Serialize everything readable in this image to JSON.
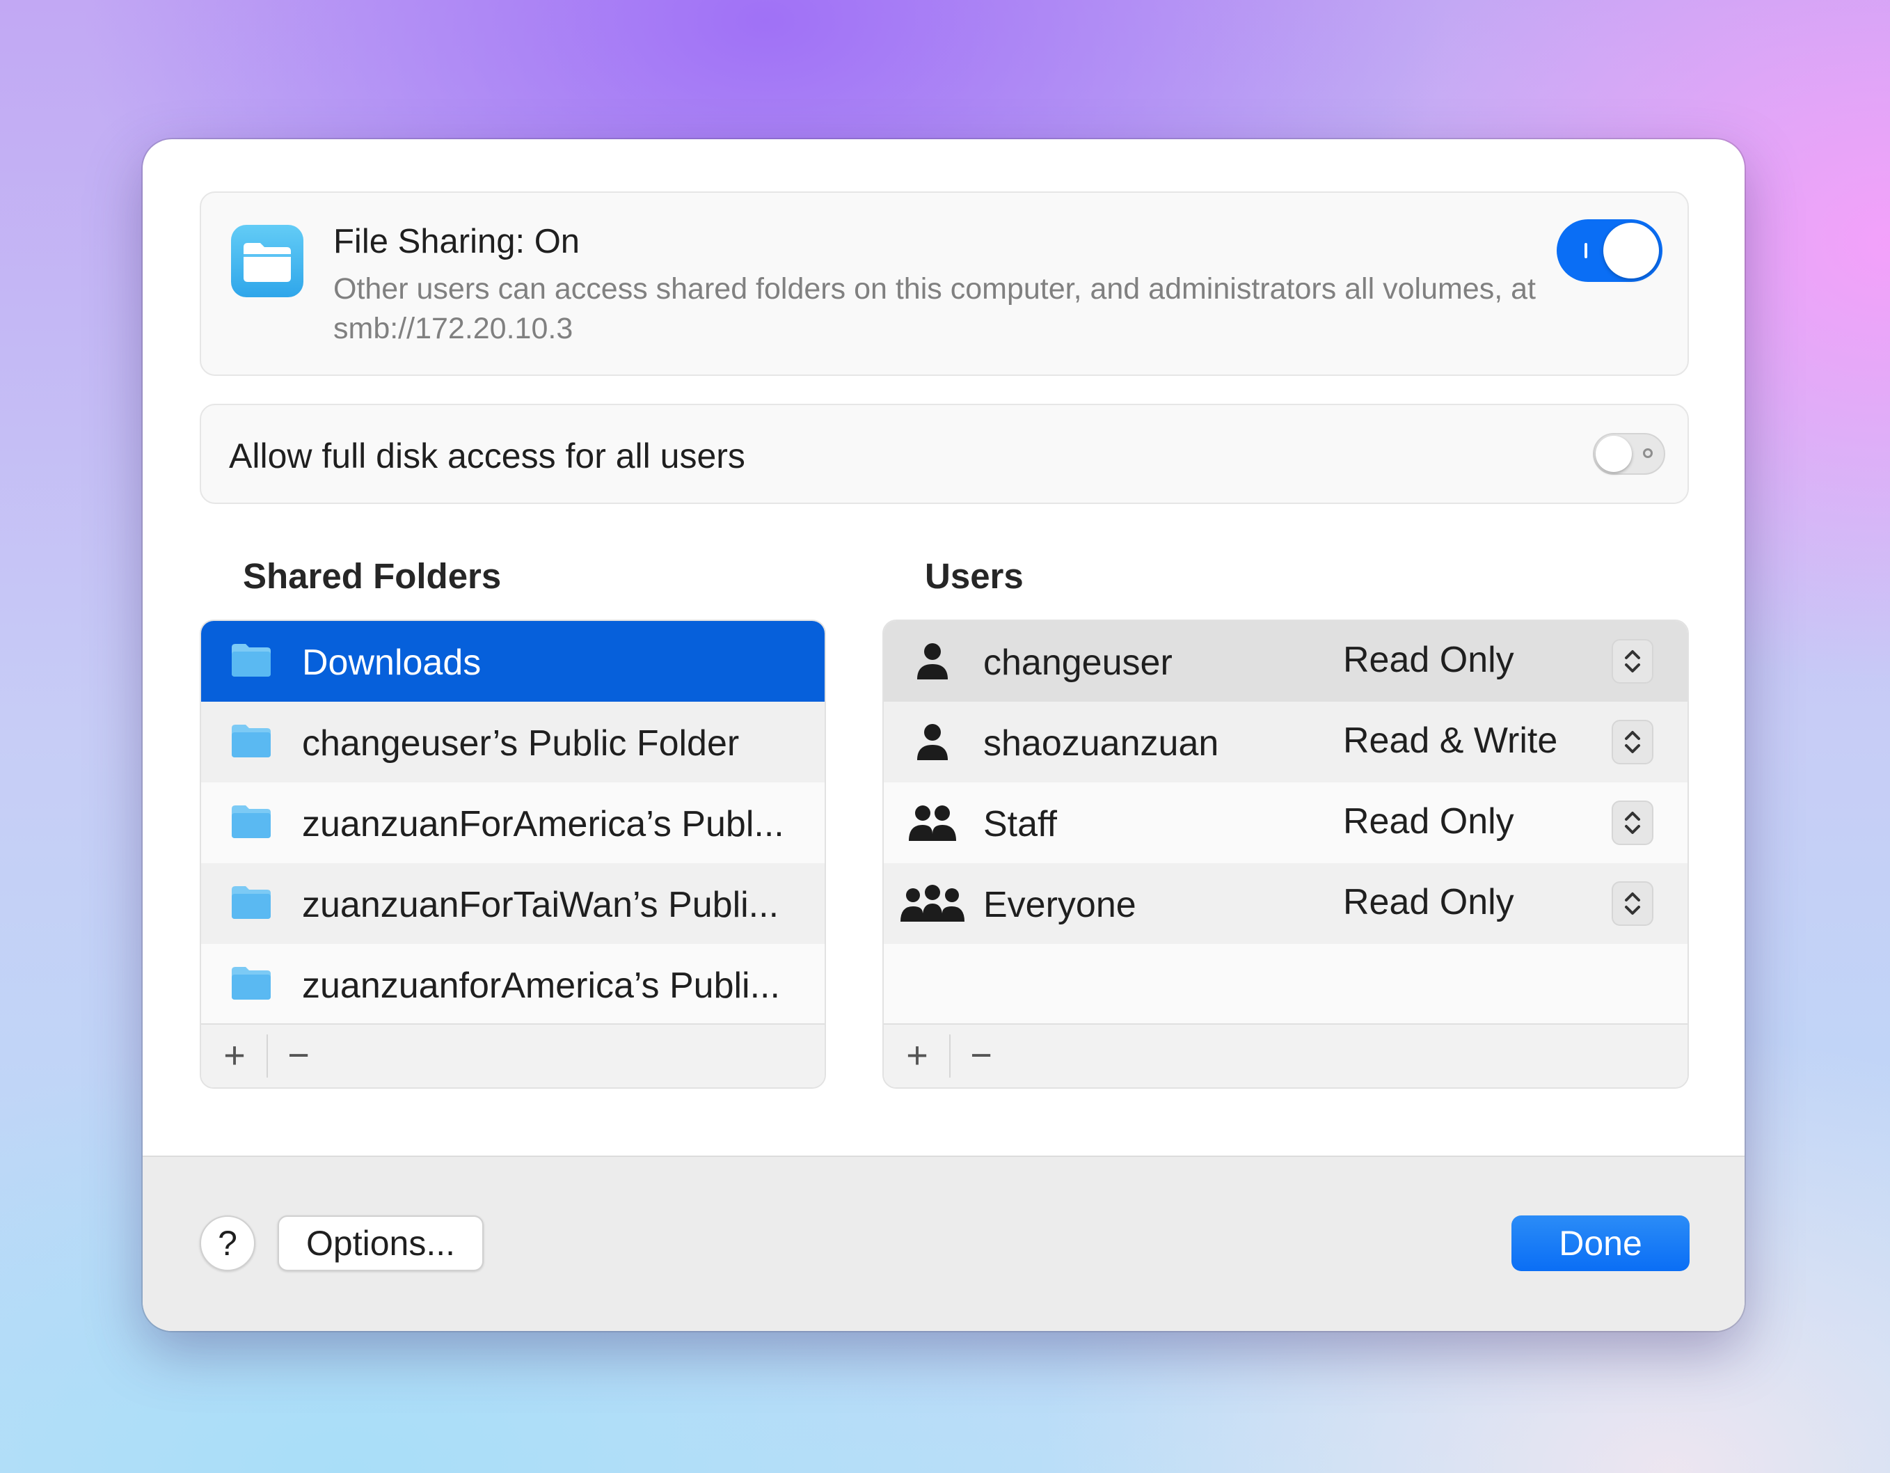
{
  "colors": {
    "accent": "#0a6ef5",
    "selection": "#0660db"
  },
  "file_sharing": {
    "icon": "folder-icon",
    "title": "File Sharing: On",
    "description": "Other users can access shared folders on this computer, and administrators all volumes, at smb://172.20.10.3",
    "toggle_on": true
  },
  "disk_access": {
    "label": "Allow full disk access for all users",
    "toggle_on": false
  },
  "shared_folders": {
    "title": "Shared Folders",
    "items": [
      {
        "label": "Downloads",
        "selected": true
      },
      {
        "label": "changeuser’s Public Folder"
      },
      {
        "label": "zuanzuanForAmerica’s Publ..."
      },
      {
        "label": "zuanzuanForTaiWan’s Publi..."
      },
      {
        "label": "zuanzuanforAmerica’s Publi..."
      }
    ],
    "add": "+",
    "remove": "−"
  },
  "users": {
    "title": "Users",
    "items": [
      {
        "name": "changeuser",
        "permission": "Read Only",
        "icon": "person-icon",
        "selected": true
      },
      {
        "name": "shaozuanzuan",
        "permission": "Read & Write",
        "icon": "person-icon"
      },
      {
        "name": "Staff",
        "permission": "Read Only",
        "icon": "group-icon"
      },
      {
        "name": "Everyone",
        "permission": "Read Only",
        "icon": "everyone-icon"
      }
    ],
    "add": "+",
    "remove": "−"
  },
  "footer": {
    "help": "?",
    "options": "Options...",
    "done": "Done"
  }
}
